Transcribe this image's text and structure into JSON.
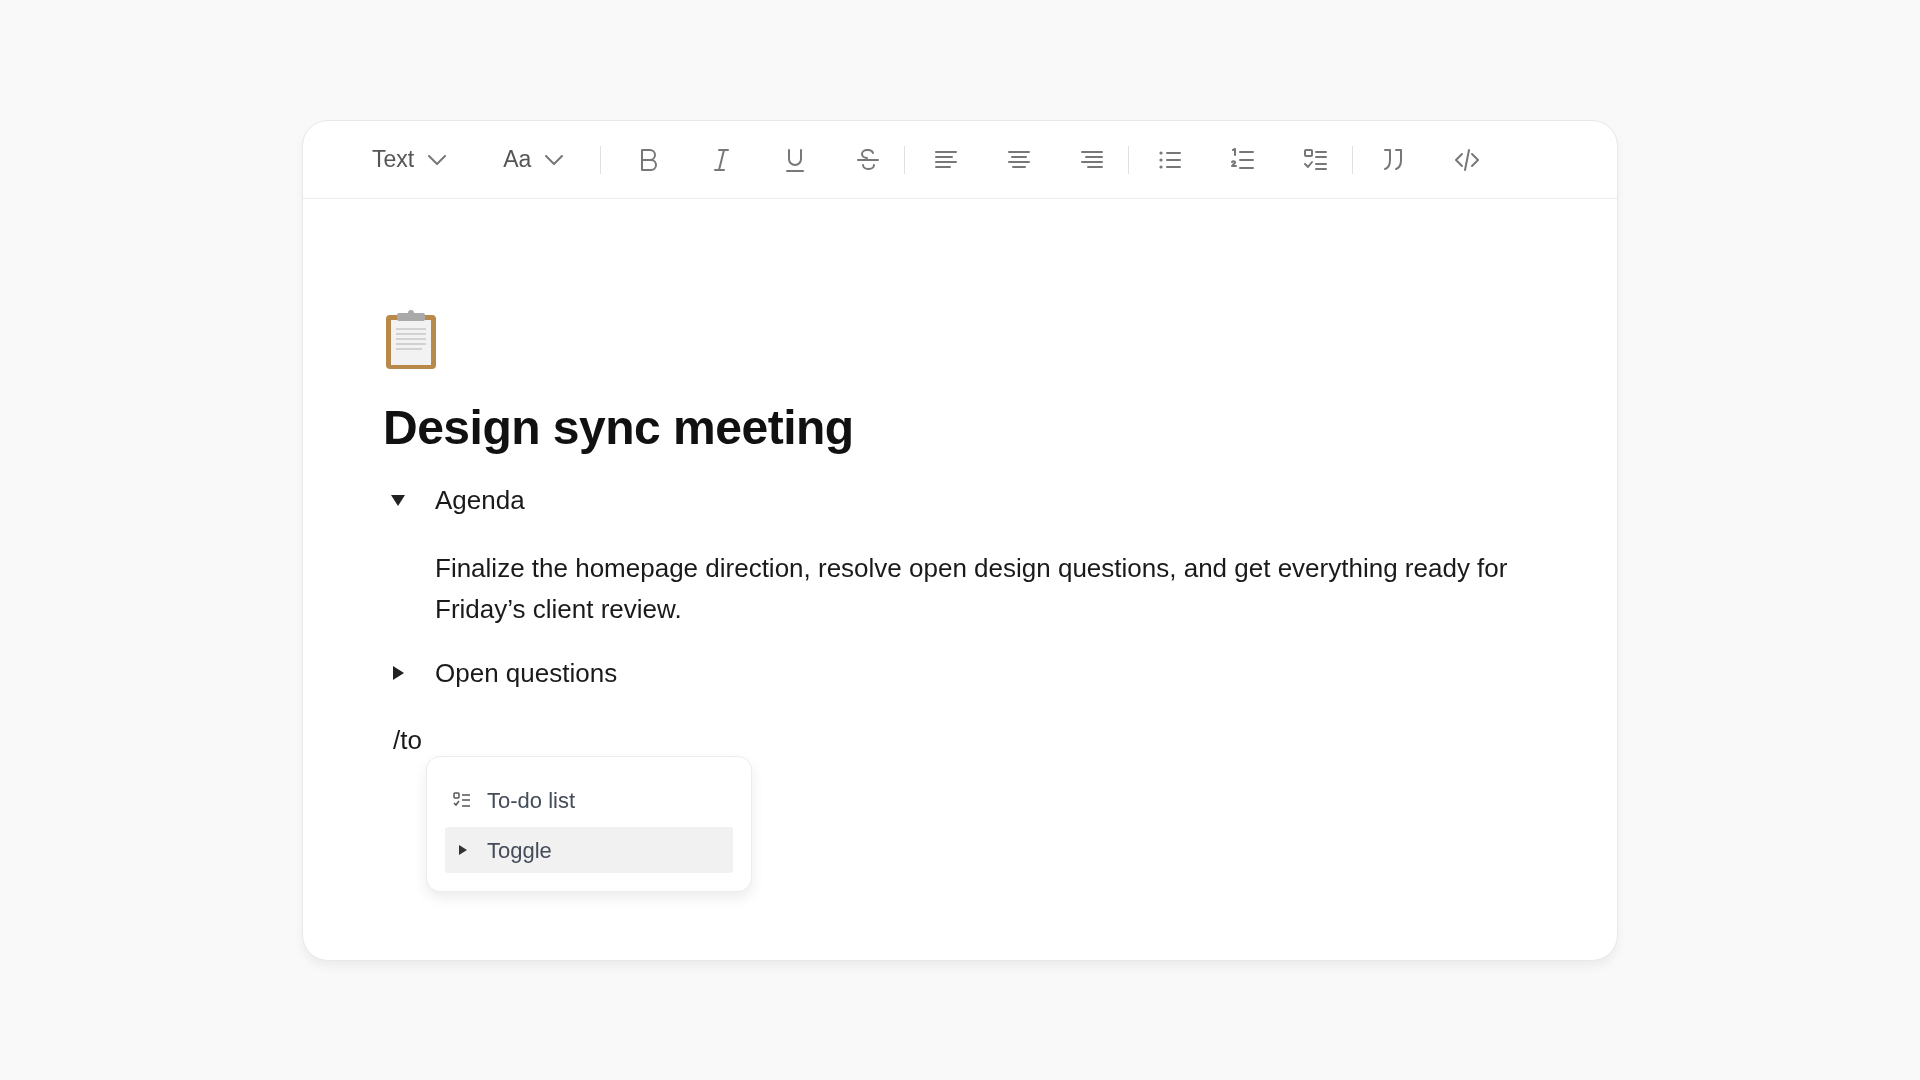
{
  "toolbar": {
    "dropdowns": [
      {
        "label": "Text"
      },
      {
        "label": "Aa"
      }
    ]
  },
  "document": {
    "title": "Design sync meeting",
    "blocks": [
      {
        "kind": "toggle",
        "label": "Agenda",
        "expanded": true,
        "children": [
          "Finalize the homepage direction, resolve open design questions, and get everything ready for Friday’s client review."
        ]
      },
      {
        "kind": "toggle",
        "label": "Open questions",
        "expanded": false
      },
      {
        "kind": "text",
        "text": "/to"
      }
    ]
  },
  "slash_menu": {
    "items": [
      {
        "kind": "todo",
        "label": "To-do list",
        "selected": false
      },
      {
        "kind": "toggle",
        "label": "Toggle",
        "selected": true
      }
    ]
  }
}
